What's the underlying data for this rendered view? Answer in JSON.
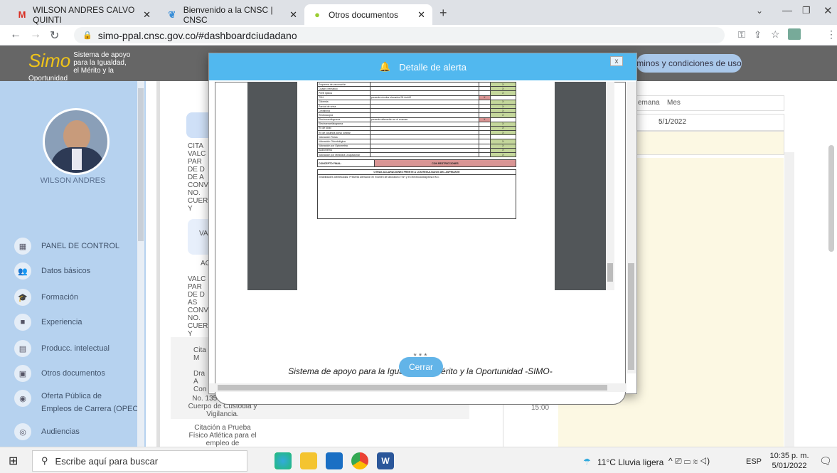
{
  "browser": {
    "tabs": [
      {
        "label": "WILSON ANDRES CALVO QUINTI",
        "icon": "gmail-icon"
      },
      {
        "label": "Bienvenido a la CNSC | CNSC",
        "icon": "cnsc-icon"
      },
      {
        "label": "Otros documentos",
        "icon": "leaf-icon"
      }
    ],
    "url": "simo-ppal.cnsc.gov.co/#dashboardciudadano"
  },
  "header": {
    "logo_text": "Simo",
    "logo_line1": "Sistema de apoyo para la Igualdad,",
    "logo_line2": "el Mérito y la Oportunidad",
    "terms": "minos y condiciones de uso"
  },
  "sidebar": {
    "user": "WILSON ANDRES",
    "items": [
      {
        "label": "PANEL DE CONTROL",
        "icon": "dashboard-icon"
      },
      {
        "label": "Datos básicos",
        "icon": "people-icon"
      },
      {
        "label": "Formación",
        "icon": "graduation-icon"
      },
      {
        "label": "Experiencia",
        "icon": "briefcase-icon"
      },
      {
        "label": "Producc. intelectual",
        "icon": "book-icon"
      },
      {
        "label": "Otros documentos",
        "icon": "document-icon"
      },
      {
        "label": "Oferta Pública de",
        "label2": "Empleos de Carrera (OPEC)",
        "icon": "globe-icon"
      },
      {
        "label": "Audiencias",
        "icon": "audience-icon"
      }
    ]
  },
  "middle": {
    "block1": "CITA\nVALC\nPAR\nDE D\nDE A\nCONV\nNO.\nCUER\nY",
    "block2": "VA",
    "block3": "AC",
    "block4": "VALC\nPAR\nDE D\nAS\nCONV\nNO.\nCUER\nY",
    "block5": "Cita\nM\n\nDra\nA\nCon",
    "bottom1": "No. 1356 de 2019 -\nCuerpo de Custodia y\nVigilancia.",
    "bottom2": "Citación a Prueba\nFísico Atlética para el\nempleo de"
  },
  "calendar": {
    "view_week": "emana",
    "view_month": "Mes",
    "date": "5/1/2022",
    "time": "15:00"
  },
  "modal": {
    "title": "Detalle de alerta",
    "close_x": "x",
    "stars": "* * *",
    "footer": "Sistema de apoyo para la Igualdad, el Mérito y la Oportunidad -SIMO-",
    "close_button": "Cerrar"
  },
  "document": {
    "rows": [
      {
        "name": "Esquema de vacunación",
        "obs": "",
        "mark": "X",
        "bad": false
      },
      {
        "name": "Cuadro hemático",
        "obs": "",
        "mark": "X",
        "bad": false
      },
      {
        "name": "Perfil lípidos",
        "obs": "",
        "mark": "X",
        "bad": false
      },
      {
        "name": "TSH",
        "obs": "presenta niveles elevados 28.4mUI/l",
        "mark": "X",
        "bad": true
      },
      {
        "name": "Glicemia",
        "obs": "",
        "mark": "X",
        "bad": false
      },
      {
        "name": "Parcial de orina",
        "obs": "",
        "mark": "X",
        "bad": false
      },
      {
        "name": "Creatinina",
        "obs": "",
        "mark": "X",
        "bad": false
      },
      {
        "name": "Recitoscopia",
        "obs": "",
        "mark": "X",
        "bad": false
      },
      {
        "name": "Electrocardiograma",
        "obs": "presenta alteración en el examen",
        "mark": "X",
        "bad": true
      },
      {
        "name": "Electroencefalograma",
        "obs": "",
        "mark": "X",
        "bad": false
      },
      {
        "name": "Rx de tórax",
        "obs": "",
        "mark": "X",
        "bad": false
      },
      {
        "name": "Rx de columna dorso lumbar",
        "obs": "",
        "mark": "X",
        "bad": false
      },
      {
        "name": "Valoración Física",
        "obs": "",
        "mark": "",
        "bad": false
      },
      {
        "name": "Valoración Odontológica",
        "obs": "",
        "mark": "X",
        "bad": false
      },
      {
        "name": "Valoración por Optometría",
        "obs": "",
        "mark": "X",
        "bad": false
      },
      {
        "name": "Audiometría",
        "obs": "",
        "mark": "X",
        "bad": false
      },
      {
        "name": "Valoración por Medicina Ocupacional",
        "obs": "",
        "mark": "X",
        "bad": false
      }
    ],
    "concept_label": "CONCEPTO FINAL:",
    "concept_value": "CON RESTRICCIONES",
    "notes_title": "OTRAS ACLARACIONES FRENTE A LOS RESULTADOS DEL ASPIRANTE",
    "notes_text": "Inhabilidades Identificadas:  Presenta alteración en examen de laboratorio TSH y en electrocardiograma EKG."
  },
  "taskbar": {
    "search_placeholder": "Escribe aquí para buscar",
    "weather": "11°C  Lluvia ligera",
    "lang": "ESP",
    "time": "10:35 p. m.",
    "date": "5/01/2022"
  }
}
